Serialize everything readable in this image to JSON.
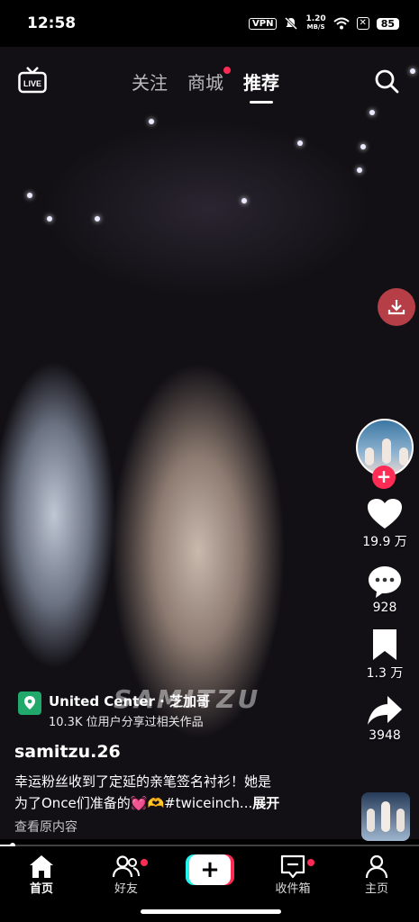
{
  "status_bar": {
    "time": "12:58",
    "vpn": "VPN",
    "speed_value": "1.20",
    "speed_unit": "MB/S",
    "battery": "85"
  },
  "top_nav": {
    "tabs": [
      {
        "label": "关注"
      },
      {
        "label": "商城",
        "has_dot": true
      },
      {
        "label": "推荐",
        "active": true
      }
    ],
    "live_label": "LIVE"
  },
  "video": {
    "watermark": "SAMITZU"
  },
  "actions": {
    "likes": "19.9 万",
    "comments": "928",
    "favorites": "1.3 万",
    "shares": "3948"
  },
  "location": {
    "name": "United Center · 芝加哥",
    "subtitle": "10.3K 位用户分享过相关作品"
  },
  "post": {
    "username": "samitzu.26",
    "caption_line1": "幸运粉丝收到了定延的亲笔签名衬衫！她是",
    "caption_line2": "为了Once们准备的💓🫶#twiceinch...",
    "expand": "展开",
    "view_original": "查看原内容"
  },
  "progress": {
    "value": 0.03
  },
  "bottom_nav": {
    "items": [
      {
        "label": "首页",
        "active": true
      },
      {
        "label": "好友",
        "has_dot": true
      },
      {
        "label": "收件箱",
        "has_dot": true
      },
      {
        "label": "主页"
      }
    ]
  },
  "colors": {
    "accent": "#fe2c55",
    "cyan": "#25f4ee",
    "location_green": "#21a86b"
  }
}
